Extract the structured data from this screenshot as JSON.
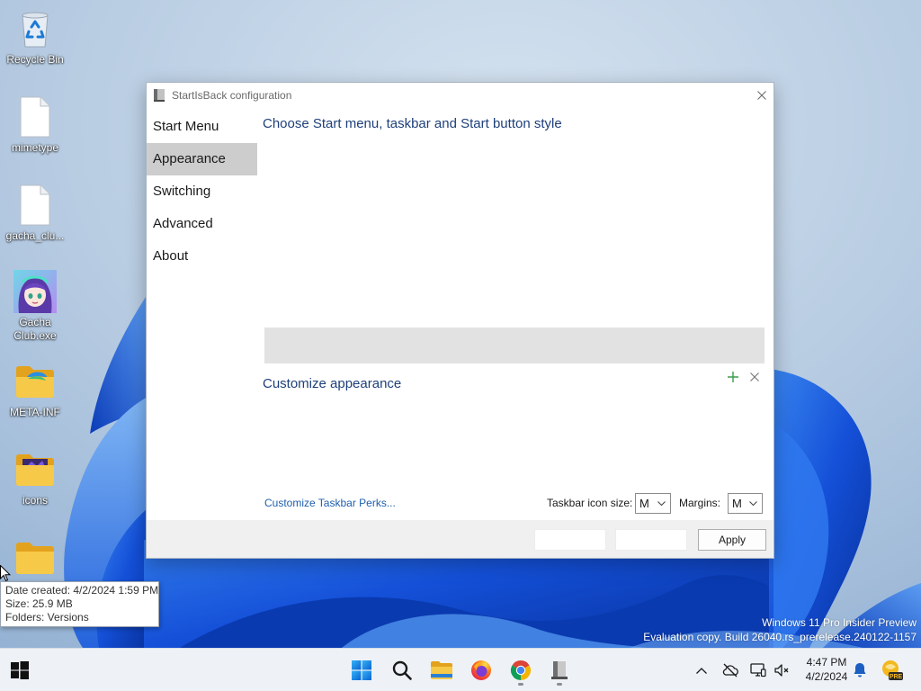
{
  "desktop": {
    "icons": [
      {
        "label": "Recycle Bin",
        "icon": "recycle-bin-icon"
      },
      {
        "label": "mimetype",
        "icon": "file-icon"
      },
      {
        "label": "gacha_clu...",
        "icon": "file-icon"
      },
      {
        "label": "Gacha Club.exe",
        "icon": "gacha-club-app-icon"
      },
      {
        "label": "META-INF",
        "icon": "folder-icon"
      },
      {
        "label": "icons",
        "icon": "folder-icon"
      },
      {
        "icon": "folder-icon"
      }
    ],
    "tooltip": {
      "date_created": "Date created: 4/2/2024 1:59 PM",
      "size": "Size: 25.9 MB",
      "folders": "Folders: Versions"
    },
    "watermark": {
      "edition": "Windows 11 Pro Insider Preview",
      "build": "Evaluation copy. Build 26040.rs_prerelease.240122-1157"
    }
  },
  "window": {
    "title": "StartIsBack configuration",
    "icon": "startisback-icon",
    "nav": [
      {
        "label": "Start Menu"
      },
      {
        "label": "Appearance",
        "selected": true
      },
      {
        "label": "Switching"
      },
      {
        "label": "Advanced"
      },
      {
        "label": "About"
      }
    ],
    "content": {
      "style_heading": "Choose Start menu, taskbar and Start button style",
      "customize_heading": "Customize appearance",
      "perks_link": "Customize Taskbar Perks...",
      "icon_size_label": "Taskbar icon size:",
      "icon_size_value": "M",
      "margins_label": "Margins:",
      "margins_value": "M"
    },
    "footer": {
      "apply_label": "Apply"
    }
  },
  "taskbar": {
    "start_icon": "windows-icon",
    "pinned": [
      "windows11-start-icon",
      "search-icon",
      "file-explorer-icon",
      "firefox-icon",
      "chrome-icon",
      "startisback-icon"
    ],
    "tray": {
      "icons": [
        "chevron-up-icon",
        "network-offline-icon",
        "display-icon",
        "speaker-muted-icon",
        "bell-icon",
        "pre-badge-icon"
      ],
      "time": "4:47 PM",
      "date": "4/2/2024",
      "pre_badge": "PRE"
    }
  },
  "colors": {
    "heading": "#1e3f7a",
    "link": "#1f5fae",
    "nav_selected_bg": "#cdcdcd",
    "add_icon": "#3a9e4a"
  }
}
